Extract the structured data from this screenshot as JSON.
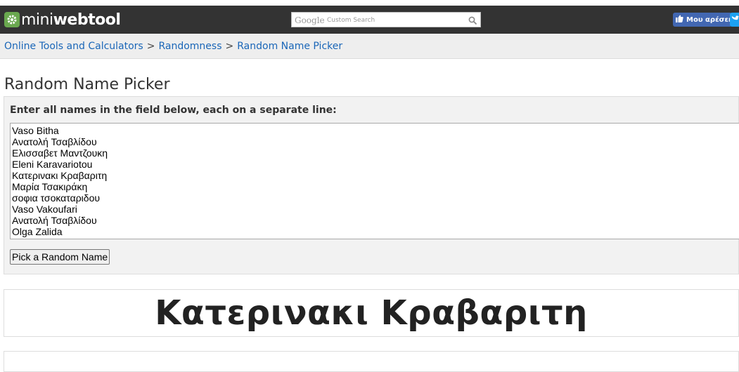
{
  "header": {
    "logo_mini": "mini",
    "logo_web": "webtool",
    "search_google": "Google",
    "search_placeholder": "Custom Search",
    "fb_label": "Μου αρέσει",
    "brand_color": "#333333"
  },
  "breadcrumb": {
    "items": [
      "Online Tools and Calculators",
      "Randomness",
      "Random Name Picker"
    ],
    "separator": ">"
  },
  "page_title": "Random Name Picker",
  "form": {
    "instruction": "Enter all names in the field below, each on a separate line:",
    "names": "Vaso Bitha\nΑνατολή Τσαβλίδου\nΕλισσαβετ Μαντζουκη\nEleni Karavariotou\nΚατερινακι Κραβαριτη\nΜαρία Τσακιράκη\nσοφια τσοκαταριδου\nVaso Vakoufari\nΑνατολή Τσαβλίδου\nOlga Zalida",
    "button_label": "Pick a Random Name"
  },
  "result": {
    "picked_name": "Κατερινακι Κραβαριτη"
  }
}
